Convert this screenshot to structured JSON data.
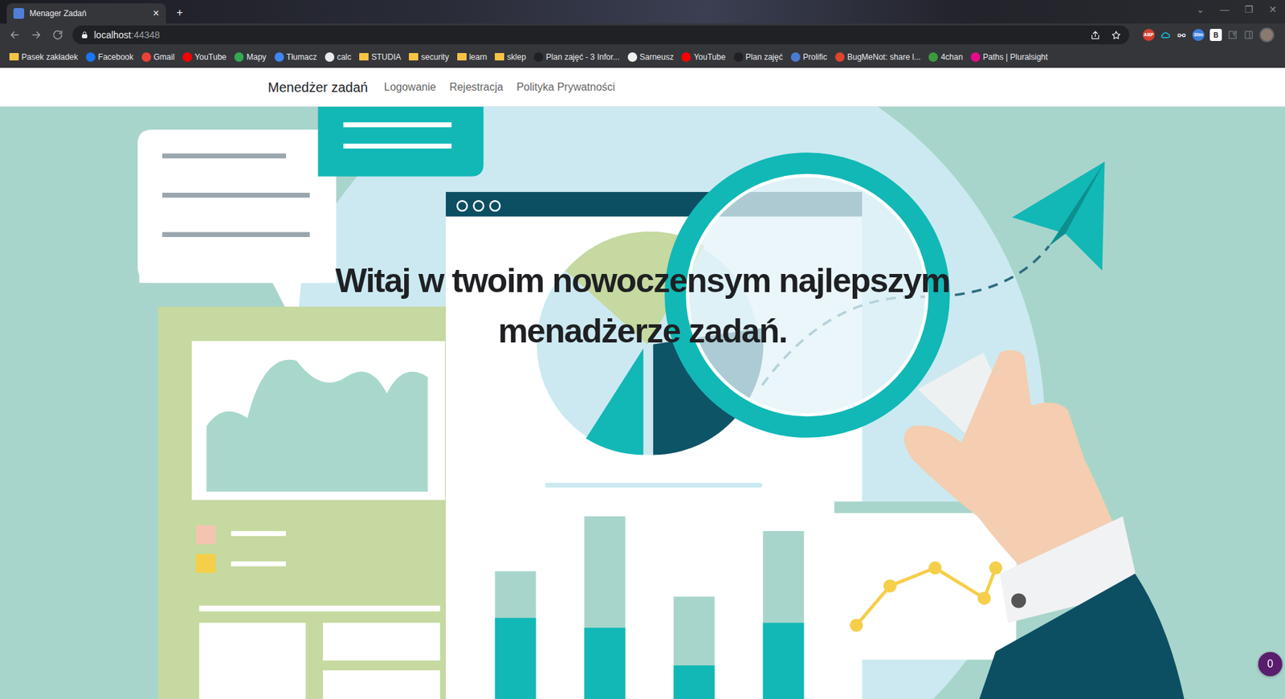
{
  "window": {
    "title": "Menager Zadań",
    "close_tab": "×",
    "new_tab": "+",
    "controls": [
      "⌄",
      "—",
      "❐",
      "✕"
    ]
  },
  "toolbar": {
    "address": "localhost",
    "port": ":44348",
    "extensions": [
      {
        "label": "ABP",
        "color": "#d23f31"
      },
      {
        "label": "30m",
        "color": "#3b7ddd"
      },
      {
        "label": "B",
        "color": "#ffffff"
      }
    ]
  },
  "bookmarks": [
    {
      "label": "Pasek zakładek",
      "kind": "folder",
      "color": "#f6c445"
    },
    {
      "label": "Facebook",
      "kind": "site",
      "color": "#1877f2"
    },
    {
      "label": "Gmail",
      "kind": "site",
      "color": "#ea4335"
    },
    {
      "label": "YouTube",
      "kind": "site",
      "color": "#ff0000"
    },
    {
      "label": "Mapy",
      "kind": "site",
      "color": "#34a853"
    },
    {
      "label": "Tłumacz",
      "kind": "site",
      "color": "#4285f4"
    },
    {
      "label": "calc",
      "kind": "site",
      "color": "#e8eaed"
    },
    {
      "label": "STUDIA",
      "kind": "folder",
      "color": "#f6c445"
    },
    {
      "label": "security",
      "kind": "folder",
      "color": "#f6c445"
    },
    {
      "label": "learn",
      "kind": "folder",
      "color": "#f6c445"
    },
    {
      "label": "sklep",
      "kind": "folder",
      "color": "#f6c445"
    },
    {
      "label": "Plan zajęć - 3 Infor...",
      "kind": "site",
      "color": "#202124"
    },
    {
      "label": "Sarneusz",
      "kind": "site",
      "color": "#f0f0f0"
    },
    {
      "label": "YouTube",
      "kind": "site",
      "color": "#ff0000"
    },
    {
      "label": "Plan zajęć",
      "kind": "site",
      "color": "#202124"
    },
    {
      "label": "Prolific",
      "kind": "site",
      "color": "#4a7bd0"
    },
    {
      "label": "BugMeNot: share l...",
      "kind": "site",
      "color": "#e0452b"
    },
    {
      "label": "4chan",
      "kind": "site",
      "color": "#3c9a3c"
    },
    {
      "label": "Paths | Pluralsight",
      "kind": "site",
      "color": "#e80a89"
    }
  ],
  "navbar": {
    "brand": "Menedżer zadań",
    "links": [
      "Logowanie",
      "Rejestracja",
      "Polityka Prywatności"
    ]
  },
  "hero": {
    "heading": "Witaj w twoim nowoczensym najlepszym menadżerze zadań."
  },
  "badge": {
    "count": "0"
  }
}
